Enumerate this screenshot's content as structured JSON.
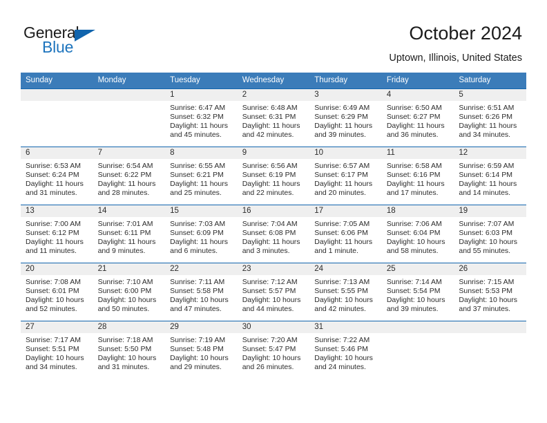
{
  "brand": {
    "name_top": "General",
    "name_bottom": "Blue",
    "triangle_icon": "brand-triangle-icon",
    "accent_color": "#1064ad"
  },
  "header": {
    "title": "October 2024",
    "subtitle": "Uptown, Illinois, United States"
  },
  "theme": {
    "header_row_bg": "#3b7cb9",
    "row_border": "#1064ad",
    "daynum_band_bg": "#efefef",
    "text": "#2b2b2b"
  },
  "weekdays": [
    "Sunday",
    "Monday",
    "Tuesday",
    "Wednesday",
    "Thursday",
    "Friday",
    "Saturday"
  ],
  "weeks": [
    [
      {
        "day": "",
        "sunrise": "",
        "sunset": "",
        "daylight": "",
        "empty": true
      },
      {
        "day": "",
        "sunrise": "",
        "sunset": "",
        "daylight": "",
        "empty": true
      },
      {
        "day": "1",
        "sunrise": "Sunrise: 6:47 AM",
        "sunset": "Sunset: 6:32 PM",
        "daylight": "Daylight: 11 hours and 45 minutes."
      },
      {
        "day": "2",
        "sunrise": "Sunrise: 6:48 AM",
        "sunset": "Sunset: 6:31 PM",
        "daylight": "Daylight: 11 hours and 42 minutes."
      },
      {
        "day": "3",
        "sunrise": "Sunrise: 6:49 AM",
        "sunset": "Sunset: 6:29 PM",
        "daylight": "Daylight: 11 hours and 39 minutes."
      },
      {
        "day": "4",
        "sunrise": "Sunrise: 6:50 AM",
        "sunset": "Sunset: 6:27 PM",
        "daylight": "Daylight: 11 hours and 36 minutes."
      },
      {
        "day": "5",
        "sunrise": "Sunrise: 6:51 AM",
        "sunset": "Sunset: 6:26 PM",
        "daylight": "Daylight: 11 hours and 34 minutes."
      }
    ],
    [
      {
        "day": "6",
        "sunrise": "Sunrise: 6:53 AM",
        "sunset": "Sunset: 6:24 PM",
        "daylight": "Daylight: 11 hours and 31 minutes."
      },
      {
        "day": "7",
        "sunrise": "Sunrise: 6:54 AM",
        "sunset": "Sunset: 6:22 PM",
        "daylight": "Daylight: 11 hours and 28 minutes."
      },
      {
        "day": "8",
        "sunrise": "Sunrise: 6:55 AM",
        "sunset": "Sunset: 6:21 PM",
        "daylight": "Daylight: 11 hours and 25 minutes."
      },
      {
        "day": "9",
        "sunrise": "Sunrise: 6:56 AM",
        "sunset": "Sunset: 6:19 PM",
        "daylight": "Daylight: 11 hours and 22 minutes."
      },
      {
        "day": "10",
        "sunrise": "Sunrise: 6:57 AM",
        "sunset": "Sunset: 6:17 PM",
        "daylight": "Daylight: 11 hours and 20 minutes."
      },
      {
        "day": "11",
        "sunrise": "Sunrise: 6:58 AM",
        "sunset": "Sunset: 6:16 PM",
        "daylight": "Daylight: 11 hours and 17 minutes."
      },
      {
        "day": "12",
        "sunrise": "Sunrise: 6:59 AM",
        "sunset": "Sunset: 6:14 PM",
        "daylight": "Daylight: 11 hours and 14 minutes."
      }
    ],
    [
      {
        "day": "13",
        "sunrise": "Sunrise: 7:00 AM",
        "sunset": "Sunset: 6:12 PM",
        "daylight": "Daylight: 11 hours and 11 minutes."
      },
      {
        "day": "14",
        "sunrise": "Sunrise: 7:01 AM",
        "sunset": "Sunset: 6:11 PM",
        "daylight": "Daylight: 11 hours and 9 minutes."
      },
      {
        "day": "15",
        "sunrise": "Sunrise: 7:03 AM",
        "sunset": "Sunset: 6:09 PM",
        "daylight": "Daylight: 11 hours and 6 minutes."
      },
      {
        "day": "16",
        "sunrise": "Sunrise: 7:04 AM",
        "sunset": "Sunset: 6:08 PM",
        "daylight": "Daylight: 11 hours and 3 minutes."
      },
      {
        "day": "17",
        "sunrise": "Sunrise: 7:05 AM",
        "sunset": "Sunset: 6:06 PM",
        "daylight": "Daylight: 11 hours and 1 minute."
      },
      {
        "day": "18",
        "sunrise": "Sunrise: 7:06 AM",
        "sunset": "Sunset: 6:04 PM",
        "daylight": "Daylight: 10 hours and 58 minutes."
      },
      {
        "day": "19",
        "sunrise": "Sunrise: 7:07 AM",
        "sunset": "Sunset: 6:03 PM",
        "daylight": "Daylight: 10 hours and 55 minutes."
      }
    ],
    [
      {
        "day": "20",
        "sunrise": "Sunrise: 7:08 AM",
        "sunset": "Sunset: 6:01 PM",
        "daylight": "Daylight: 10 hours and 52 minutes."
      },
      {
        "day": "21",
        "sunrise": "Sunrise: 7:10 AM",
        "sunset": "Sunset: 6:00 PM",
        "daylight": "Daylight: 10 hours and 50 minutes."
      },
      {
        "day": "22",
        "sunrise": "Sunrise: 7:11 AM",
        "sunset": "Sunset: 5:58 PM",
        "daylight": "Daylight: 10 hours and 47 minutes."
      },
      {
        "day": "23",
        "sunrise": "Sunrise: 7:12 AM",
        "sunset": "Sunset: 5:57 PM",
        "daylight": "Daylight: 10 hours and 44 minutes."
      },
      {
        "day": "24",
        "sunrise": "Sunrise: 7:13 AM",
        "sunset": "Sunset: 5:55 PM",
        "daylight": "Daylight: 10 hours and 42 minutes."
      },
      {
        "day": "25",
        "sunrise": "Sunrise: 7:14 AM",
        "sunset": "Sunset: 5:54 PM",
        "daylight": "Daylight: 10 hours and 39 minutes."
      },
      {
        "day": "26",
        "sunrise": "Sunrise: 7:15 AM",
        "sunset": "Sunset: 5:53 PM",
        "daylight": "Daylight: 10 hours and 37 minutes."
      }
    ],
    [
      {
        "day": "27",
        "sunrise": "Sunrise: 7:17 AM",
        "sunset": "Sunset: 5:51 PM",
        "daylight": "Daylight: 10 hours and 34 minutes."
      },
      {
        "day": "28",
        "sunrise": "Sunrise: 7:18 AM",
        "sunset": "Sunset: 5:50 PM",
        "daylight": "Daylight: 10 hours and 31 minutes."
      },
      {
        "day": "29",
        "sunrise": "Sunrise: 7:19 AM",
        "sunset": "Sunset: 5:48 PM",
        "daylight": "Daylight: 10 hours and 29 minutes."
      },
      {
        "day": "30",
        "sunrise": "Sunrise: 7:20 AM",
        "sunset": "Sunset: 5:47 PM",
        "daylight": "Daylight: 10 hours and 26 minutes."
      },
      {
        "day": "31",
        "sunrise": "Sunrise: 7:22 AM",
        "sunset": "Sunset: 5:46 PM",
        "daylight": "Daylight: 10 hours and 24 minutes."
      },
      {
        "day": "",
        "sunrise": "",
        "sunset": "",
        "daylight": "",
        "empty": true
      },
      {
        "day": "",
        "sunrise": "",
        "sunset": "",
        "daylight": "",
        "empty": true
      }
    ]
  ]
}
